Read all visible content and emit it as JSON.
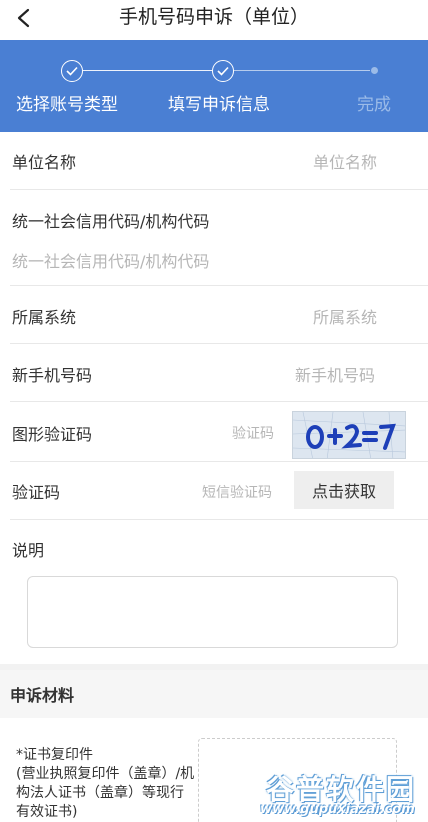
{
  "header": {
    "title": "手机号码申诉（单位）"
  },
  "steps": [
    {
      "label": "选择账号类型",
      "state": "done"
    },
    {
      "label": "填写申诉信息",
      "state": "done"
    },
    {
      "label": "完成",
      "state": "pending"
    }
  ],
  "form": {
    "unit_name": {
      "label": "单位名称",
      "placeholder": "单位名称"
    },
    "credit_code": {
      "label": "统一社会信用代码/机构代码",
      "placeholder": "统一社会信用代码/机构代码"
    },
    "system": {
      "label": "所属系统",
      "placeholder": "所属系统"
    },
    "new_phone": {
      "label": "新手机号码",
      "placeholder": "新手机号码"
    },
    "captcha": {
      "label": "图形验证码",
      "placeholder": "验证码"
    },
    "sms_code": {
      "label": "验证码",
      "placeholder": "短信验证码",
      "button": "点击获取"
    },
    "note": {
      "label": "说明"
    }
  },
  "materials": {
    "title": "申诉材料",
    "item_text": "*证书复印件\n(营业执照复印件（盖章）/机构法人证书（盖章）等现行有效证书)"
  },
  "watermark": {
    "main": "谷普软件园",
    "url": "www.gupuxiazai.com"
  },
  "colors": {
    "accent": "#4a7fd3",
    "placeholder": "#b6b6b6"
  }
}
